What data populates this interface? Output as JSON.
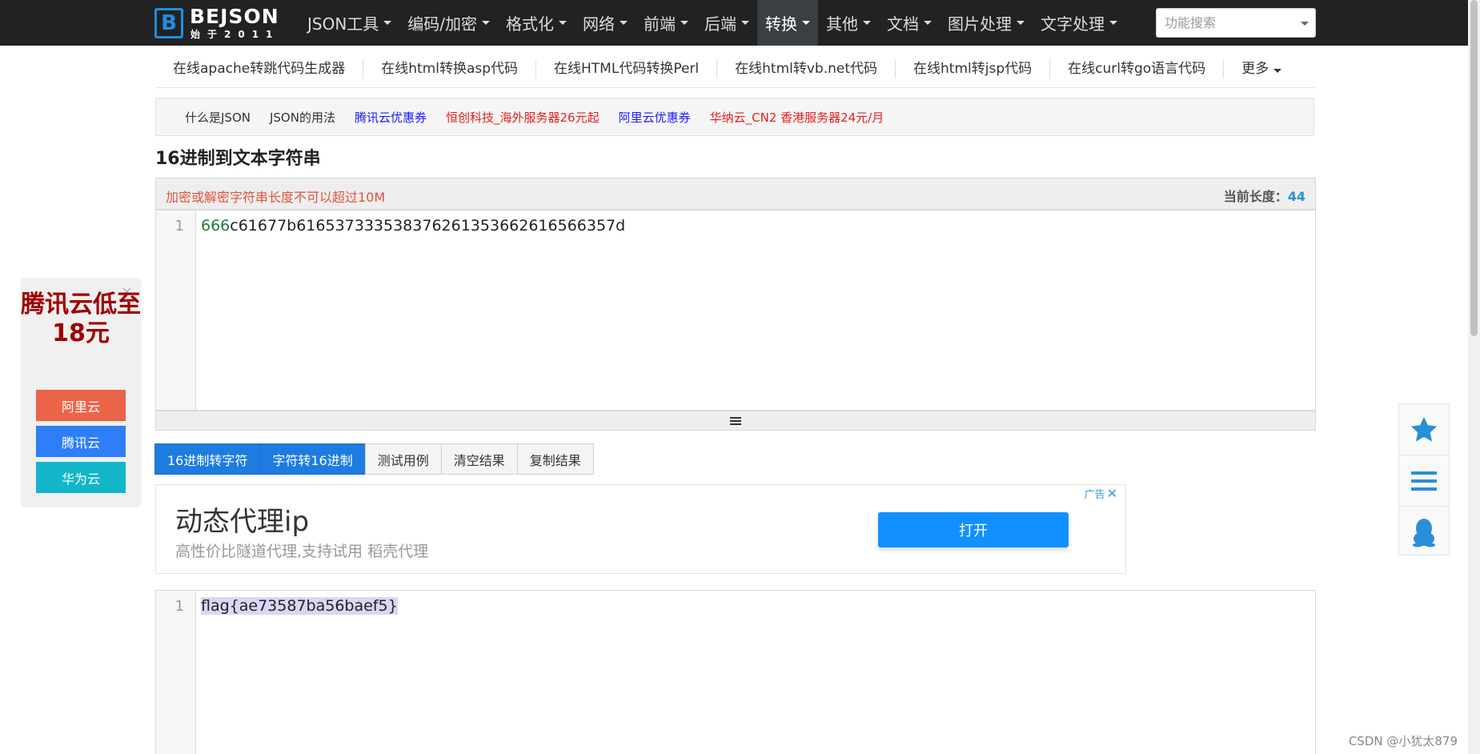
{
  "nav": {
    "logo_title": "BEJSON",
    "logo_subtitle": "始于2011",
    "logo_letter": "B",
    "items": [
      {
        "label": "JSON工具"
      },
      {
        "label": "编码/加密"
      },
      {
        "label": "格式化"
      },
      {
        "label": "网络"
      },
      {
        "label": "前端"
      },
      {
        "label": "后端"
      },
      {
        "label": "转换",
        "active": true
      },
      {
        "label": "其他"
      },
      {
        "label": "文档"
      },
      {
        "label": "图片处理"
      },
      {
        "label": "文字处理"
      }
    ],
    "search_placeholder": "功能搜索"
  },
  "subnav": {
    "items": [
      "在线apache转跳代码生成器",
      "在线html转换asp代码",
      "在线HTML代码转换Perl",
      "在线html转vb.net代码",
      "在线html转jsp代码",
      "在线curl转go语言代码"
    ],
    "more_label": "更多"
  },
  "links": [
    {
      "label": "什么是JSON",
      "color": "#333333"
    },
    {
      "label": "JSON的用法",
      "color": "#333333"
    },
    {
      "label": "腾讯云优惠券",
      "color": "#1a1aff"
    },
    {
      "label": "恒创科技_海外服务器26元起",
      "color": "#e61e1e"
    },
    {
      "label": "阿里云优惠券",
      "color": "#1a1aff"
    },
    {
      "label": "华纳云_CN2 香港服务器24元/月",
      "color": "#e61e1e"
    }
  ],
  "page_title": "16进制到文本字符串",
  "input_panel": {
    "warning": "加密或解密字符串长度不可以超过10M",
    "length_label": "当前长度：",
    "length_value": "44",
    "line_number": "1",
    "code_prefix": "666",
    "code_rest": "c61677b616537333538376261353662616566357d"
  },
  "buttons": [
    {
      "label": "16进制转字符",
      "primary": true
    },
    {
      "label": "字符转16进制",
      "primary": true
    },
    {
      "label": "测试用例",
      "primary": false
    },
    {
      "label": "清空结果",
      "primary": false
    },
    {
      "label": "复制结果",
      "primary": false
    }
  ],
  "ad": {
    "title": "动态代理ip",
    "subtitle": "高性价比隧道代理,支持试用 稻壳代理",
    "button": "打开",
    "label": "广告"
  },
  "output_panel": {
    "line_number": "1",
    "text": "flag{ae73587ba56baef5}"
  },
  "left_ad": {
    "headline": "腾讯云低至18元",
    "buttons": [
      {
        "label": "阿里云",
        "color": "#ea6449"
      },
      {
        "label": "腾讯云",
        "color": "#2d7ef7"
      },
      {
        "label": "华为云",
        "color": "#12b6c8"
      }
    ]
  },
  "float_bar": {
    "icons": [
      "star-icon",
      "menu-icon",
      "qq-penguin-icon"
    ],
    "accent": "#2a8ed8"
  },
  "watermark": "CSDN @小犹太879"
}
